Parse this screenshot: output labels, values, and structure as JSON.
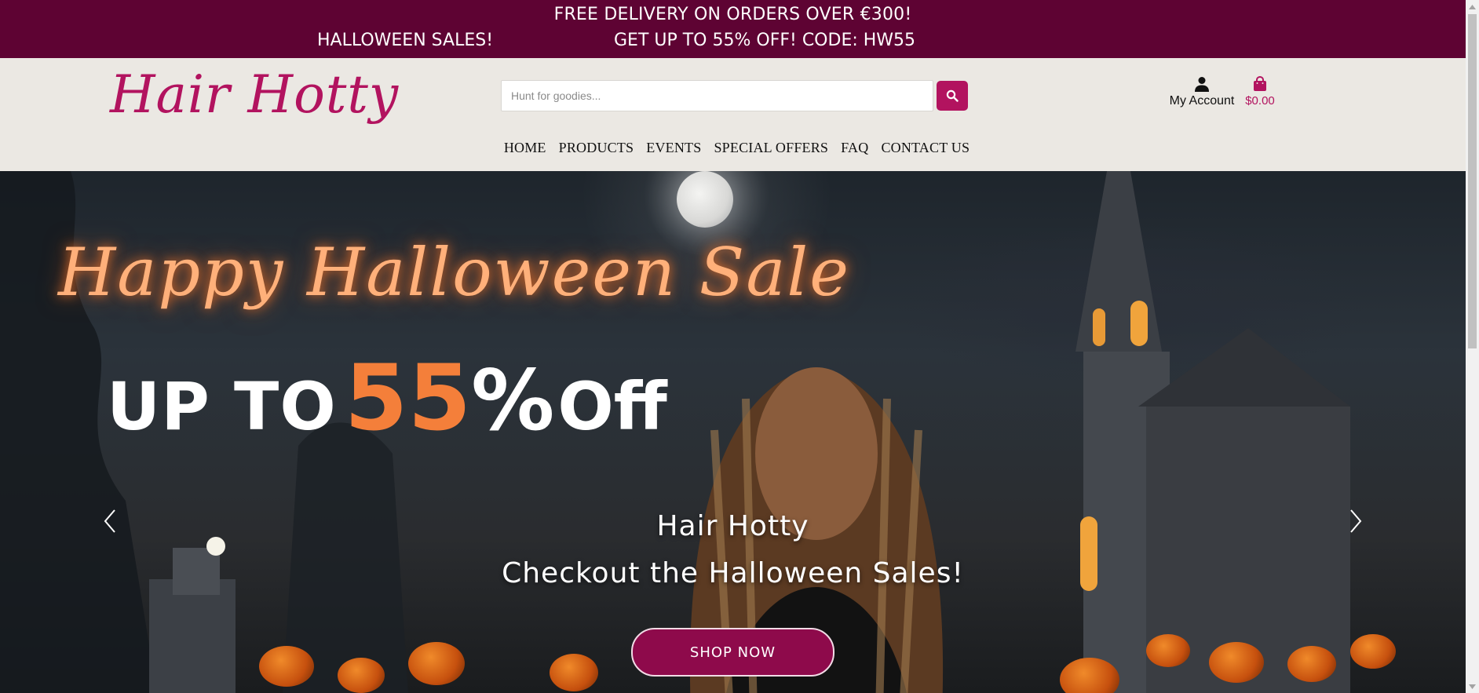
{
  "promo": {
    "line1": "FREE DELIVERY ON ORDERS OVER €300!",
    "line2_left": "HALLOWEEN SALES!",
    "line2_right": "GET UP TO 55% OFF! CODE: HW55"
  },
  "header": {
    "logo": "Hair Hotty",
    "search": {
      "placeholder": "Hunt for goodies...",
      "value": ""
    },
    "account_label": "My Account",
    "cart_total": "$0.00"
  },
  "nav": {
    "items": [
      {
        "label": "HOME"
      },
      {
        "label": "PRODUCTS"
      },
      {
        "label": "EVENTS"
      },
      {
        "label": "SPECIAL OFFERS"
      },
      {
        "label": "FAQ"
      },
      {
        "label": "CONTACT US"
      }
    ]
  },
  "hero": {
    "banner_script": "Happy Halloween Sale",
    "banner_upto": "UP TO",
    "banner_number": "55",
    "banner_percent": "%",
    "banner_off": "Off",
    "caption_title": "Hair Hotty",
    "caption_subtitle": "Checkout the Halloween Sales!",
    "cta_label": "SHOP NOW"
  },
  "icons": {
    "search": "search-icon",
    "account": "user-icon",
    "cart": "shopping-bag-icon",
    "prev": "chevron-left-icon",
    "next": "chevron-right-icon"
  },
  "colors": {
    "promo_bg": "#5e0333",
    "brand": "#b2135f",
    "header_bg": "#ebe8e3",
    "cta_bg": "#8e0a4b",
    "accent_orange": "#f47f3a"
  }
}
